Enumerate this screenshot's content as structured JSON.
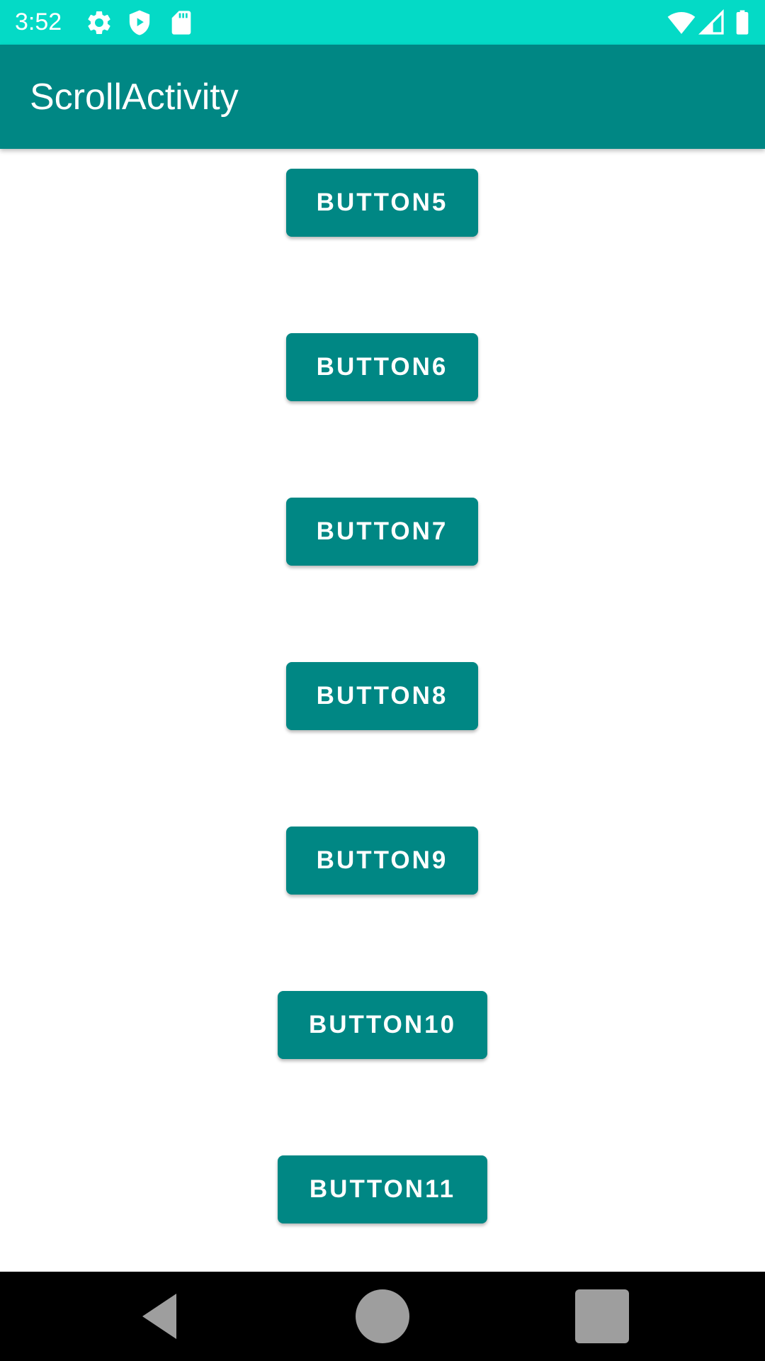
{
  "status_bar": {
    "time": "3:52",
    "background": "#04dac6",
    "icons_left": [
      "settings-icon",
      "play-protect-icon",
      "sd-card-icon"
    ],
    "icons_right": [
      "wifi-icon",
      "cell-signal-icon",
      "battery-icon"
    ]
  },
  "app_bar": {
    "title": "ScrollActivity",
    "background": "#008784"
  },
  "buttons": [
    {
      "label": "BUTTON5"
    },
    {
      "label": "BUTTON6"
    },
    {
      "label": "BUTTON7"
    },
    {
      "label": "BUTTON8"
    },
    {
      "label": "BUTTON9"
    },
    {
      "label": "BUTTON10"
    },
    {
      "label": "BUTTON11"
    }
  ],
  "button_color": "#008784",
  "nav_bar": {
    "items": [
      "back-icon",
      "home-icon",
      "recents-icon"
    ]
  }
}
